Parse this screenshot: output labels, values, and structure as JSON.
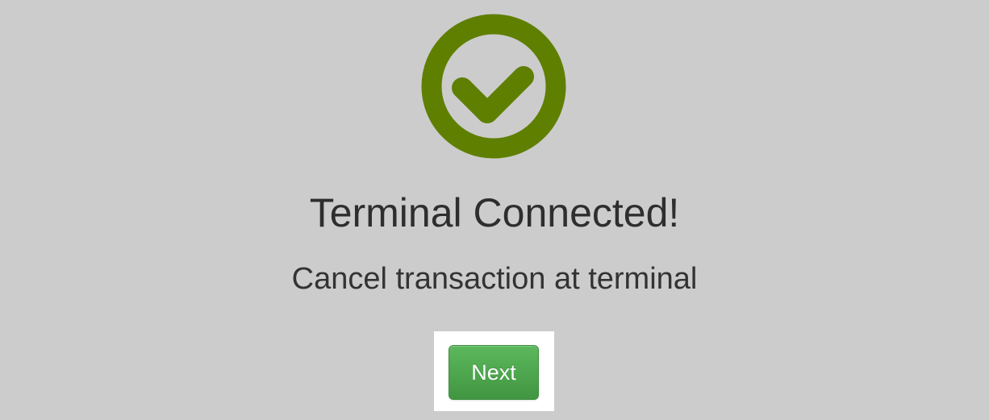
{
  "status": {
    "icon": "check-circle-icon",
    "icon_color": "#5f7f00",
    "title": "Terminal Connected!",
    "message": "Cancel transaction at terminal"
  },
  "actions": {
    "next_label": "Next",
    "next_color": "#4cae4c"
  }
}
